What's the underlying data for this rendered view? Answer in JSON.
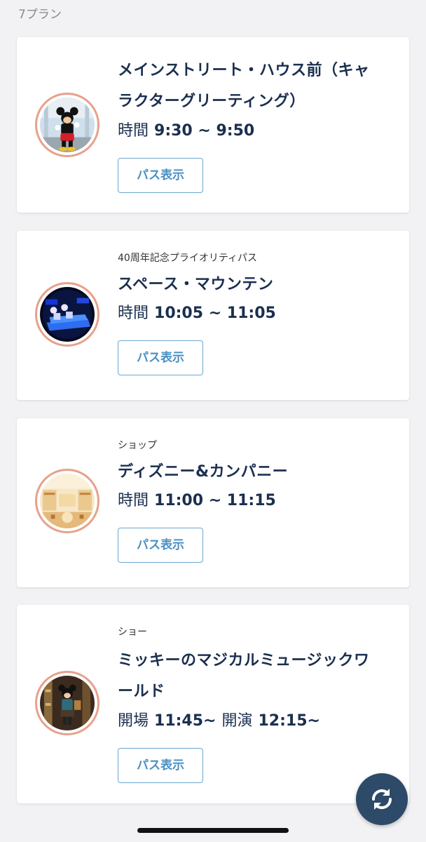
{
  "header": {
    "plan_count": "7プラン"
  },
  "plans": [
    {
      "category": "",
      "title_line1": "メインストリート・ハウス前（キャ",
      "title_line2": "ラクターグリーティング）",
      "time_label": "時間",
      "time_value": "9:30 ~ 9:50",
      "button_label": "パス表示",
      "thumbnail_icon": "character-greeting-photo"
    },
    {
      "category": "40周年記念プライオリティパス",
      "title_line1": "スペース・マウンテン",
      "time_label": "時間",
      "time_value": "10:05 ~ 11:05",
      "button_label": "パス表示",
      "thumbnail_icon": "attraction-photo"
    },
    {
      "category": "ショップ",
      "title_line1": "ディズニー&カンパニー",
      "time_label": "時間",
      "time_value": "11:00 ~ 11:15",
      "button_label": "パス表示",
      "thumbnail_icon": "shop-photo"
    },
    {
      "category": "ショー",
      "title_line1": "ミッキーのマジカルミュージックワ",
      "title_line2": "ールド",
      "time_label": "開場",
      "time_value": "11:45~",
      "time_label2": "開演",
      "time_value2": "12:15~",
      "button_label": "パス表示",
      "thumbnail_icon": "show-photo"
    }
  ],
  "fab": {
    "icon": "refresh-icon"
  },
  "colors": {
    "title": "#1b2f4f",
    "button_border": "#6aa7cf",
    "button_text": "#4a90c2",
    "thumb_ring": "#e8a08b",
    "fab": "#2d4a68"
  }
}
